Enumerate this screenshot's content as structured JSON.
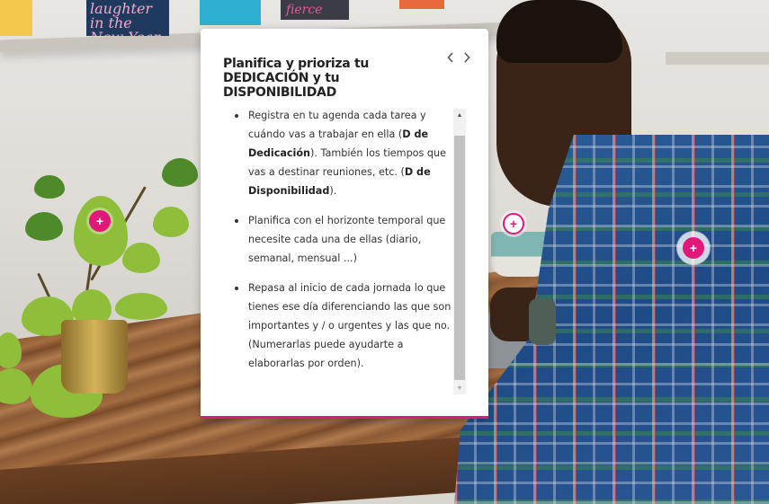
{
  "background": {
    "card_laughter_text": "laughter in the New Year",
    "card_fierce_text": "fierce"
  },
  "panel": {
    "title": "Planifica y prioriza tu DEDICACIÓN y tu DISPONIBILIDAD",
    "prev_icon": "chevron-left-icon",
    "next_icon": "chevron-right-icon",
    "bullets": [
      {
        "t1": "Registra en tu agenda cada tarea y cuándo vas a trabajar en ella (",
        "b1": "D de Dedicación",
        "t2": "). También los tiempos que vas a destinar reuniones, etc. (",
        "b2": "D de Disponibilidad",
        "t3": ")."
      },
      {
        "t1": "Planifica con el horizonte temporal que necesite cada una de ellas (diario, semanal, mensual ...)"
      },
      {
        "t1": "Repasa al inicio de cada jornada lo que tienes ese día diferenciando las que son importantes y / o urgentes y las que no. (Numerarlas puede ayudarte a elaborarlas por orden)."
      }
    ],
    "accent_color": "#e0187a"
  },
  "hotspots": {
    "plant_symbol": "+",
    "cup_symbol": "+",
    "shirt_symbol": "+"
  }
}
